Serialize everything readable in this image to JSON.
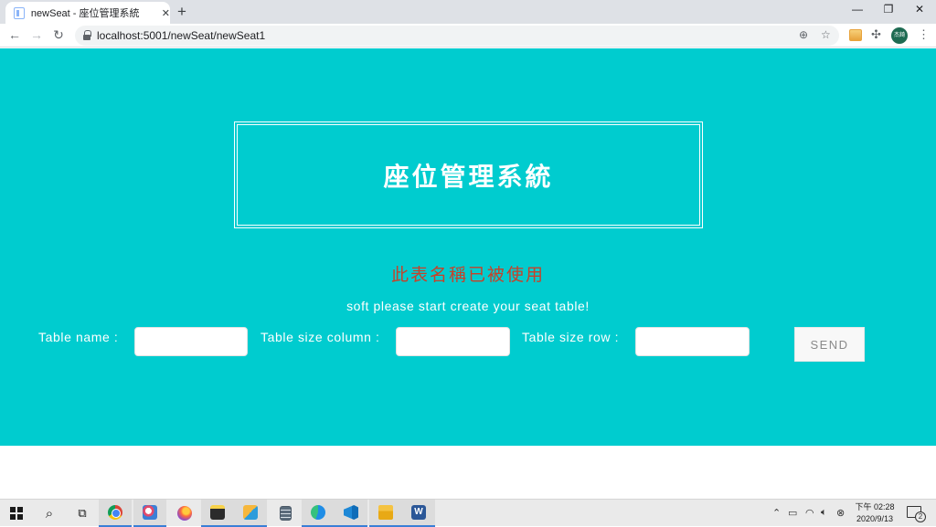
{
  "browser": {
    "tab_title": "newSeat - 座位管理系統",
    "tab_close": "✕",
    "new_tab": "+",
    "url": "localhost:5001/newSeat/newSeat1",
    "window_controls": [
      "—",
      "❐",
      "✕"
    ],
    "avatar_text": "杰錡"
  },
  "page": {
    "title": "座位管理系統",
    "error_message": "此表名稱已被使用",
    "subtitle": "soft please start create your seat table!",
    "form": {
      "table_name_label": "Table name :",
      "table_column_label": "Table size column :",
      "table_row_label": "Table size row :",
      "table_name_value": "",
      "table_column_value": "",
      "table_row_value": "",
      "send_label": "SEND"
    }
  },
  "taskbar": {
    "apps": [
      "start-icon",
      "search-icon",
      "task-view-icon",
      "chrome-icon",
      "paint-icon",
      "firefox-icon",
      "sticky-notes-icon",
      "snip-icon",
      "calculator-icon",
      "edge-icon",
      "vscode-icon",
      "file-explorer-icon",
      "word-icon"
    ],
    "clock_time": "下午 02:28",
    "clock_date": "2020/9/13",
    "notification_count": "2"
  },
  "colors": {
    "page_background": "#00cccf",
    "error_text": "#c84128",
    "title_text": "#ffffff"
  }
}
